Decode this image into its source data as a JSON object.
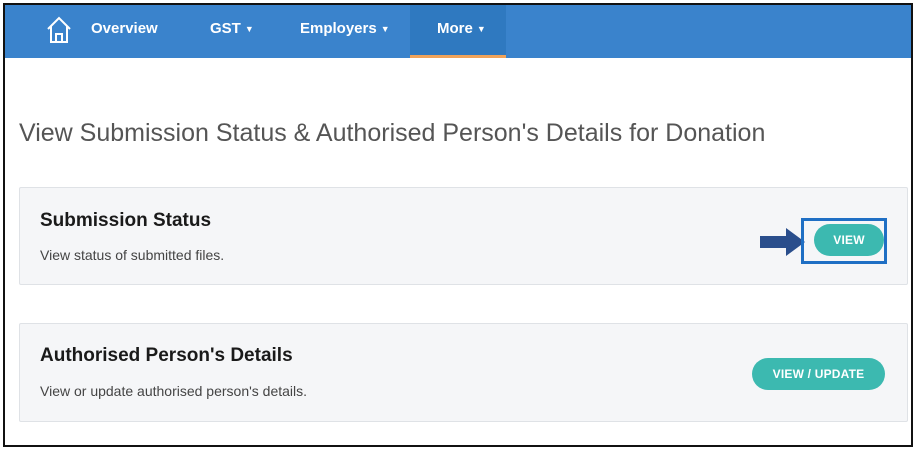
{
  "nav": {
    "items": [
      {
        "label": "Overview"
      },
      {
        "label": "GST"
      },
      {
        "label": "Employers"
      },
      {
        "label": "More"
      }
    ],
    "caret": "▼"
  },
  "page": {
    "title": "View Submission Status & Authorised Person's Details for Donation"
  },
  "cards": [
    {
      "title": "Submission Status",
      "description": "View status of submitted files.",
      "button_label": "VIEW"
    },
    {
      "title": "Authorised Person's Details",
      "description": "View or update authorised person's details.",
      "button_label": "VIEW / UPDATE"
    }
  ],
  "colors": {
    "nav_bg": "#3a83cc",
    "nav_active_underline": "#f0a35a",
    "button_teal": "#3cb9b0",
    "highlight_blue": "#1f6fc4",
    "arrow_navy": "#2a4e8c"
  }
}
